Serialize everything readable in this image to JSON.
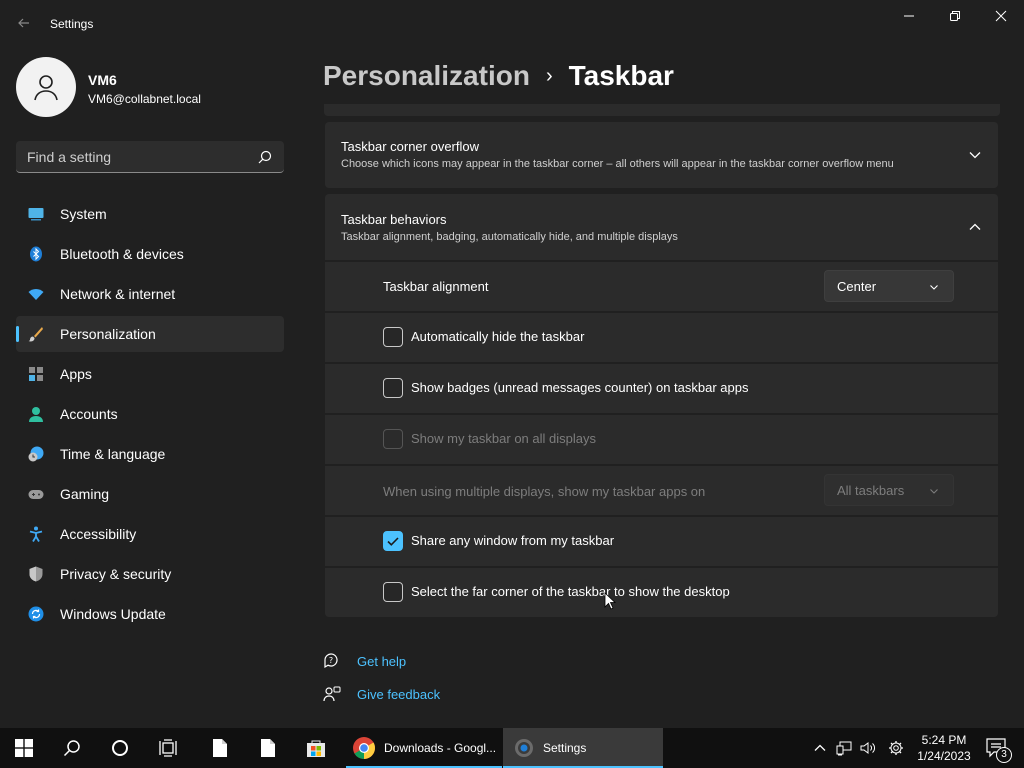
{
  "window": {
    "title": "Settings"
  },
  "profile": {
    "name": "VM6",
    "email": "VM6@collabnet.local"
  },
  "search": {
    "placeholder": "Find a setting"
  },
  "nav": {
    "items": [
      {
        "label": "System",
        "icon": "system-icon"
      },
      {
        "label": "Bluetooth & devices",
        "icon": "bluetooth-icon"
      },
      {
        "label": "Network & internet",
        "icon": "wifi-icon"
      },
      {
        "label": "Personalization",
        "icon": "brush-icon",
        "active": true
      },
      {
        "label": "Apps",
        "icon": "apps-icon"
      },
      {
        "label": "Accounts",
        "icon": "person-icon"
      },
      {
        "label": "Time & language",
        "icon": "clock-globe-icon"
      },
      {
        "label": "Gaming",
        "icon": "gamepad-icon"
      },
      {
        "label": "Accessibility",
        "icon": "accessibility-icon"
      },
      {
        "label": "Privacy & security",
        "icon": "shield-icon"
      },
      {
        "label": "Windows Update",
        "icon": "update-icon"
      }
    ]
  },
  "breadcrumb": {
    "parent": "Personalization",
    "separator": "›",
    "current": "Taskbar"
  },
  "sections": {
    "overflow": {
      "title": "Taskbar corner overflow",
      "desc": "Choose which icons may appear in the taskbar corner – all others will appear in the taskbar corner overflow menu"
    },
    "behaviors": {
      "title": "Taskbar behaviors",
      "desc": "Taskbar alignment, badging, automatically hide, and multiple displays",
      "alignment": {
        "label": "Taskbar alignment",
        "value": "Center"
      },
      "auto_hide": {
        "label": "Automatically hide the taskbar",
        "checked": false
      },
      "badges": {
        "label": "Show badges (unread messages counter) on taskbar apps",
        "checked": false
      },
      "all_displays": {
        "label": "Show my taskbar on all displays",
        "checked": false,
        "disabled": true
      },
      "multi_display": {
        "label": "When using multiple displays, show my taskbar apps on",
        "value": "All taskbars",
        "disabled": true
      },
      "share_window": {
        "label": "Share any window from my taskbar",
        "checked": true
      },
      "far_corner": {
        "label": "Select the far corner of the taskbar to show the desktop",
        "checked": false
      }
    }
  },
  "links": {
    "help": "Get help",
    "feedback": "Give feedback"
  },
  "taskbar": {
    "apps": [
      {
        "label": "Downloads - Googl...",
        "icon": "chrome-icon"
      },
      {
        "label": "Settings",
        "icon": "settings-gear-icon",
        "active": true
      }
    ],
    "time": "5:24 PM",
    "date": "1/24/2023",
    "notification_count": "3"
  },
  "colors": {
    "accent": "#4cc2ff",
    "background": "#202020",
    "card": "#2b2b2b"
  }
}
